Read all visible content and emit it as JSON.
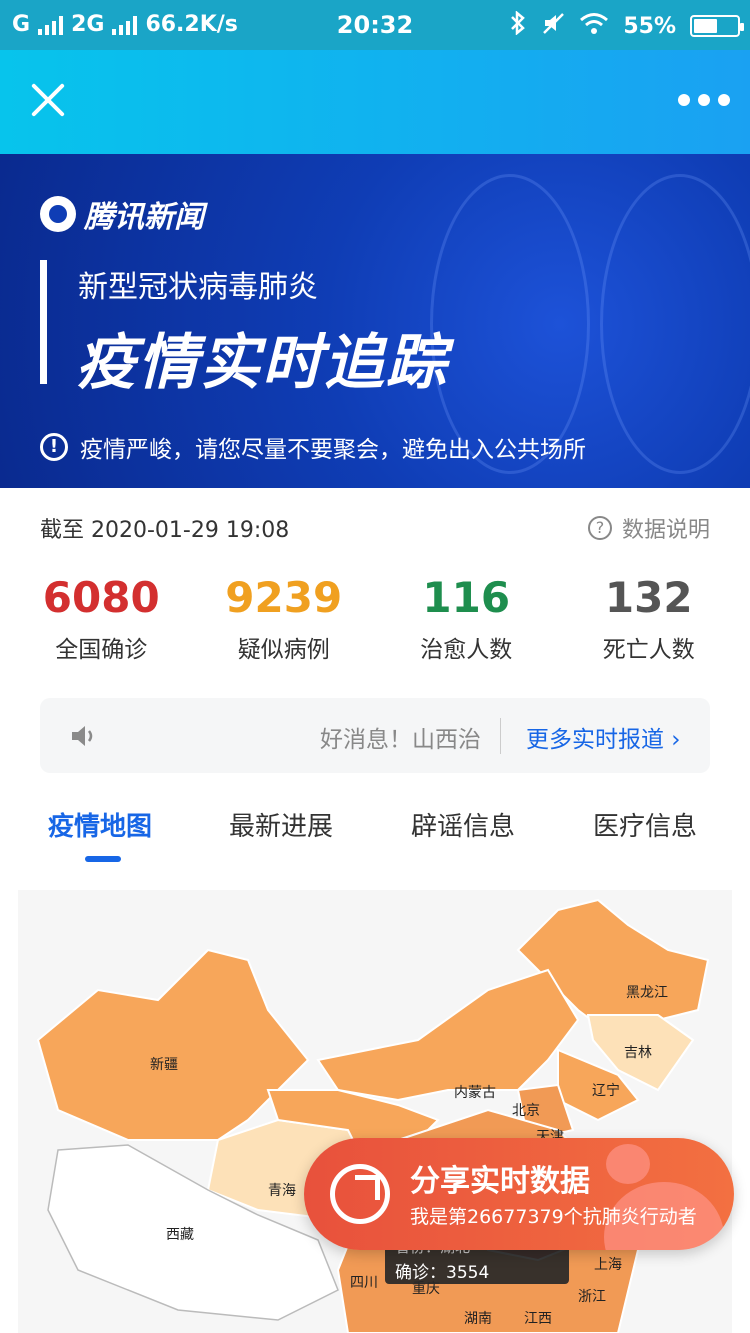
{
  "status": {
    "signal1": "G",
    "signal2": "2G",
    "speed": "66.2K/s",
    "time": "20:32",
    "battery": "55%",
    "battery_level": 0.55
  },
  "banner": {
    "logo": "腾讯新闻",
    "subtitle": "新型冠状病毒肺炎",
    "title": "疫情实时追踪",
    "warning": "疫情严峻，请您尽量不要聚会，避免出入公共场所"
  },
  "info": {
    "timestamp": "截至 2020-01-29 19:08",
    "help": "数据说明"
  },
  "stats": [
    {
      "value": "6080",
      "label": "全国确诊",
      "color": "#d32f2f"
    },
    {
      "value": "9239",
      "label": "疑似病例",
      "color": "#f0a020"
    },
    {
      "value": "116",
      "label": "治愈人数",
      "color": "#1e8e4e"
    },
    {
      "value": "132",
      "label": "死亡人数",
      "color": "#555555"
    }
  ],
  "news": {
    "text": "好消息！山西治",
    "more": "更多实时报道 ›"
  },
  "tabs": [
    "疫情地图",
    "最新进展",
    "辟谣信息",
    "医疗信息"
  ],
  "map": {
    "provinces": [
      "黑龙江",
      "吉林",
      "辽宁",
      "内蒙古",
      "北京",
      "天津",
      "新疆",
      "青海",
      "西藏",
      "四川",
      "重庆",
      "湖南",
      "江西",
      "上海",
      "浙江"
    ]
  },
  "share": {
    "title": "分享实时数据",
    "subtitle": "我是第26677379个抗肺炎行动者"
  },
  "tooltip": {
    "province": "省份：湖北",
    "confirmed": "确诊：3554"
  }
}
